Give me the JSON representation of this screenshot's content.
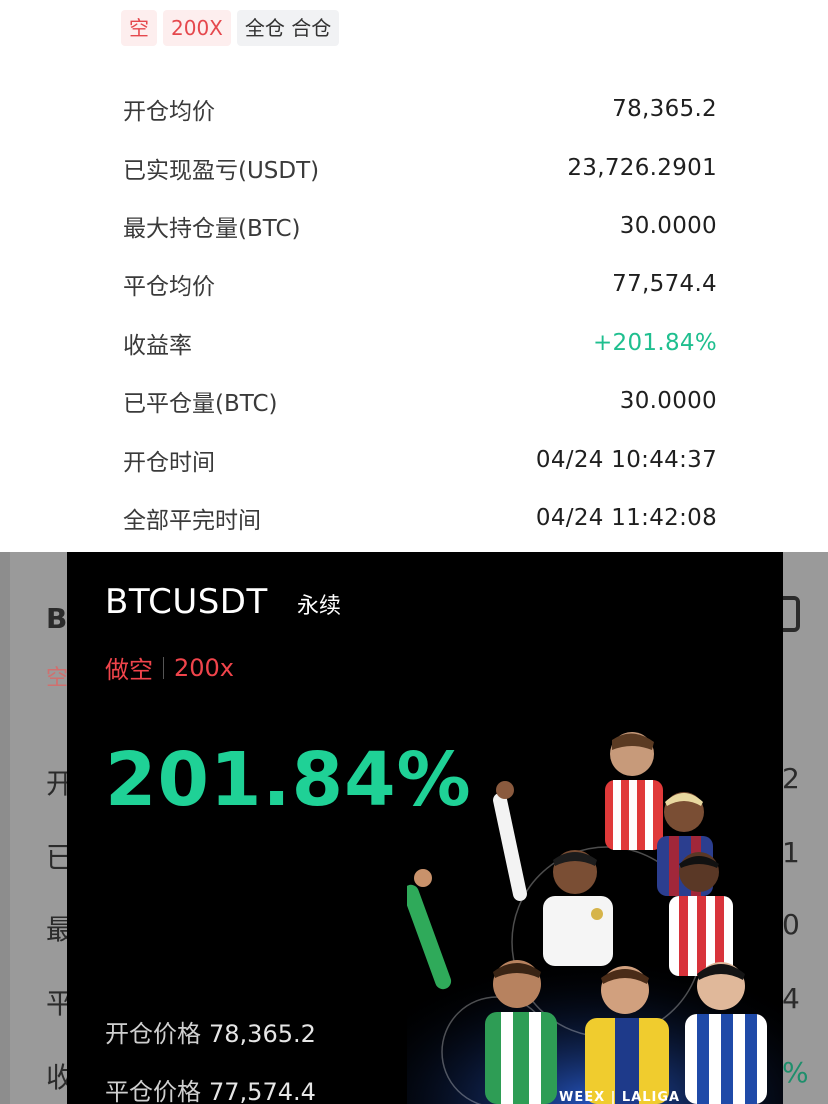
{
  "top": {
    "tags": {
      "side": "空",
      "leverage": "200X",
      "margin_mode": "全仓 合仓"
    },
    "rows": [
      {
        "label": "开仓均价",
        "value": "78,365.2",
        "positive": false
      },
      {
        "label": "已实现盈亏(USDT)",
        "value": "23,726.2901",
        "positive": false
      },
      {
        "label": "最大持仓量(BTC)",
        "value": "30.0000",
        "positive": false
      },
      {
        "label": "平仓均价",
        "value": "77,574.4",
        "positive": false
      },
      {
        "label": "收益率",
        "value": "+201.84%",
        "positive": true
      },
      {
        "label": "已平仓量(BTC)",
        "value": "30.0000",
        "positive": false
      },
      {
        "label": "开仓时间",
        "value": "04/24 10:44:37",
        "positive": false
      },
      {
        "label": "全部平完时间",
        "value": "04/24 11:42:08",
        "positive": false
      }
    ]
  },
  "background_peek": {
    "left_chars": [
      "B",
      "空",
      "开",
      "已",
      "最",
      "平",
      "收"
    ],
    "right_chars": [
      "2",
      "1",
      "0",
      "4",
      "%"
    ]
  },
  "card": {
    "symbol": "BTCUSDT",
    "contract_type": "永续",
    "side": "做空",
    "leverage": "200x",
    "roi": "201.84%",
    "open_price_label": "开仓价格",
    "open_price": "78,365.2",
    "close_price_label": "平仓价格",
    "close_price": "77,574.4",
    "brand": "WEEX | LALIGA"
  },
  "colors": {
    "positive": "#1fbf8f",
    "roi_green": "#1fd196",
    "short_red": "#f0444b",
    "tag_red": "#e5484d"
  }
}
